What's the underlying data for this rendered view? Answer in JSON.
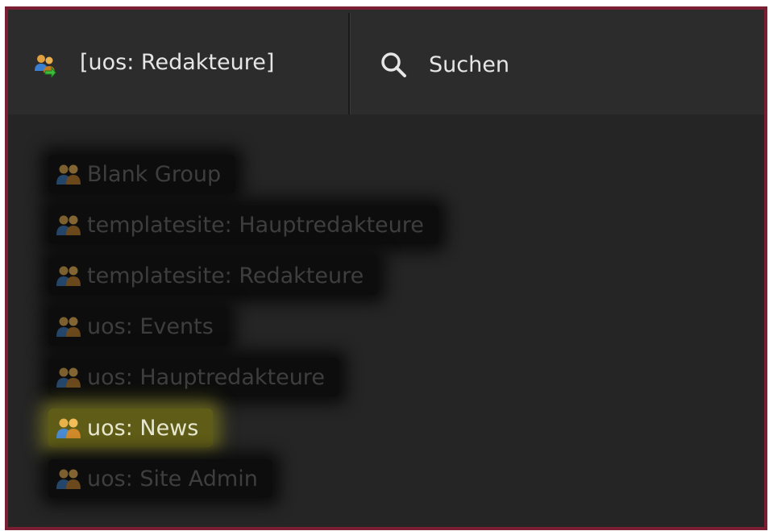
{
  "header": {
    "group_switch_label": "[uos: Redakteure]",
    "search_label": "Suchen"
  },
  "groups": [
    {
      "label": "Blank Group",
      "active": false
    },
    {
      "label": "templatesite: Hauptredakteure",
      "active": false
    },
    {
      "label": "templatesite: Redakteure",
      "active": false
    },
    {
      "label": "uos: Events",
      "active": false
    },
    {
      "label": "uos: Hauptredakteure",
      "active": false
    },
    {
      "label": "uos: News",
      "active": true
    },
    {
      "label": "uos: Site Admin",
      "active": false
    }
  ],
  "icons": {
    "group_switch": "group-switch-icon",
    "search": "search-icon",
    "group": "group-icon"
  },
  "colors": {
    "frame_border": "#7a1e34",
    "background": "#252525",
    "highlight": "#5f5c17",
    "text": "#e6e6e6",
    "dim_text": "#3e3e3e"
  }
}
